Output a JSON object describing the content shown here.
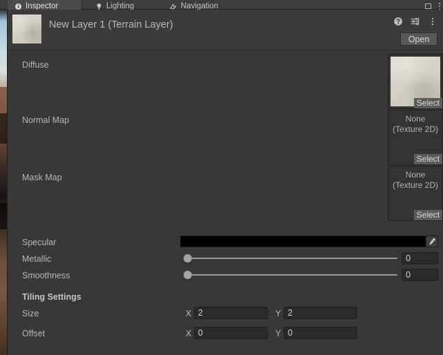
{
  "window": {
    "controls": {
      "maximize_icon": "maximize-icon",
      "menu_icon": "kebab-menu-icon"
    }
  },
  "tabs": [
    {
      "label": "Inspector",
      "icon": "info-icon",
      "active": true
    },
    {
      "label": "Lighting",
      "icon": "lightbulb-icon",
      "active": false
    },
    {
      "label": "Navigation",
      "icon": "navmesh-icon",
      "active": false
    }
  ],
  "header": {
    "title": "New Layer 1 (Terrain Layer)",
    "thumbnail": "terrain-layer-preview",
    "open_label": "Open",
    "icons": [
      {
        "name": "help-icon"
      },
      {
        "name": "preset-icon"
      },
      {
        "name": "kebab-menu-icon"
      }
    ]
  },
  "texture_slots": [
    {
      "label": "Diffuse",
      "has_texture": true,
      "value": "",
      "select_label": "Select"
    },
    {
      "label": "Normal Map",
      "has_texture": false,
      "value_line1": "None",
      "value_line2": "(Texture 2D)",
      "select_label": "Select"
    },
    {
      "label": "Mask Map",
      "has_texture": false,
      "value_line1": "None",
      "value_line2": "(Texture 2D)",
      "select_label": "Select"
    }
  ],
  "material": {
    "specular": {
      "label": "Specular",
      "color": "#000000",
      "eyedropper_icon": "eyedropper-icon"
    },
    "metallic": {
      "label": "Metallic",
      "value": "0",
      "slider_pct": 0
    },
    "smoothness": {
      "label": "Smoothness",
      "value": "0",
      "slider_pct": 0
    }
  },
  "tiling": {
    "heading": "Tiling Settings",
    "size": {
      "label": "Size",
      "x_label": "X",
      "x_value": "2",
      "y_label": "Y",
      "y_value": "2"
    },
    "offset": {
      "label": "Offset",
      "x_label": "X",
      "x_value": "0",
      "y_label": "Y",
      "y_value": "0"
    }
  },
  "colors": {
    "panel_bg": "#383838",
    "header_bg": "#3b3b3b",
    "tab_active": "#4b4b4b",
    "field_bg": "#2a2a2a",
    "text": "#b6b6b6",
    "accent_select": "#5b5b5b"
  }
}
